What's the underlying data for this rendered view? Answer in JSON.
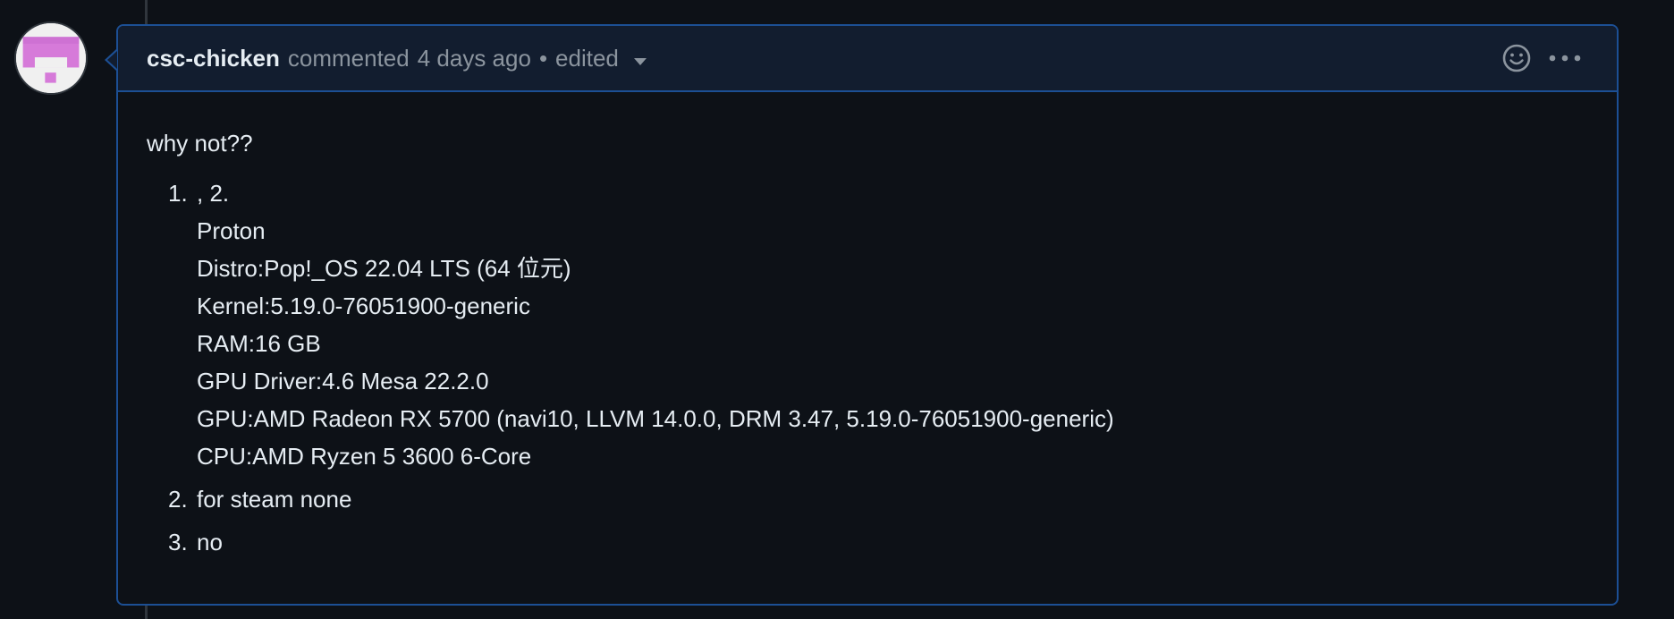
{
  "comment": {
    "author": "csc-chicken",
    "action": "commented",
    "timestamp": "4 days ago",
    "separator": "•",
    "edited_label": "edited",
    "icons": {
      "dropdown": "triangle-down-icon",
      "reaction": "smiley-icon",
      "menu": "kebab-horizontal-icon"
    },
    "colors": {
      "header_bg": "#121d2f",
      "border": "#1c4f94",
      "avatar_accent": "#d67ad9"
    },
    "body": {
      "intro": "why not??",
      "items": [
        {
          "number": "1.",
          "text": ", 2.",
          "details": [
            "Proton",
            "Distro:Pop!_OS 22.04 LTS (64 位元)",
            "Kernel:5.19.0-76051900-generic",
            "RAM:16 GB",
            "GPU Driver:4.6 Mesa 22.2.0",
            "GPU:AMD Radeon RX 5700 (navi10, LLVM 14.0.0, DRM 3.47, 5.19.0-76051900-generic)",
            "CPU:AMD Ryzen 5 3600 6-Core"
          ]
        },
        {
          "number": "2.",
          "text": "for steam none"
        },
        {
          "number": "3.",
          "text": "no"
        }
      ]
    }
  }
}
